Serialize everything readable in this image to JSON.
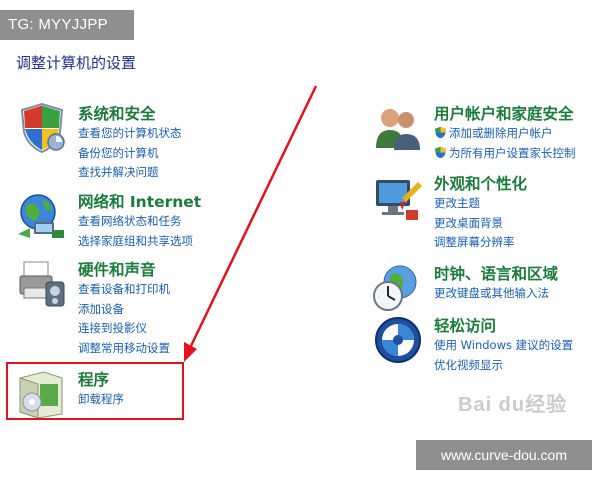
{
  "watermark": {
    "tg": "TG: MYYJJPP",
    "site": "www.curve-dou.com",
    "baidu": "Bai du经验"
  },
  "page_title": "调整计算机的设置",
  "left": [
    {
      "id": "system",
      "title": "系统和安全",
      "icon": "shield-icon",
      "links": [
        "查看您的计算机状态",
        "备份您的计算机",
        "查找并解决问题"
      ]
    },
    {
      "id": "network",
      "title": "网络和 Internet",
      "icon": "network-globe-icon",
      "links": [
        "查看网络状态和任务",
        "选择家庭组和共享选项"
      ]
    },
    {
      "id": "hardware",
      "title": "硬件和声音",
      "icon": "printer-icon",
      "links": [
        "查看设备和打印机",
        "添加设备",
        "连接到投影仪",
        "调整常用移动设置"
      ]
    },
    {
      "id": "programs",
      "title": "程序",
      "icon": "programs-box-icon",
      "links": [
        "卸载程序"
      ]
    }
  ],
  "right": [
    {
      "id": "user",
      "title": "用户帐户和家庭安全",
      "icon": "users-icon",
      "links": [
        "添加或删除用户帐户",
        "为所有用户设置家长控制"
      ]
    },
    {
      "id": "appear",
      "title": "外观和个性化",
      "icon": "monitor-paint-icon",
      "links": [
        "更改主题",
        "更改桌面背景",
        "调整屏幕分辨率"
      ]
    },
    {
      "id": "clock",
      "title": "时钟、语言和区域",
      "icon": "clock-globe-icon",
      "links": [
        "更改键盘或其他输入法"
      ]
    },
    {
      "id": "access",
      "title": "轻松访问",
      "icon": "ease-of-access-icon",
      "links": [
        "使用 Windows 建议的设置",
        "优化视频显示"
      ]
    }
  ],
  "colors": {
    "title_green": "#1c7a3c",
    "link_blue": "#1a5fb0",
    "header_blue": "#1e3287",
    "highlight_red": "#e0141c"
  }
}
